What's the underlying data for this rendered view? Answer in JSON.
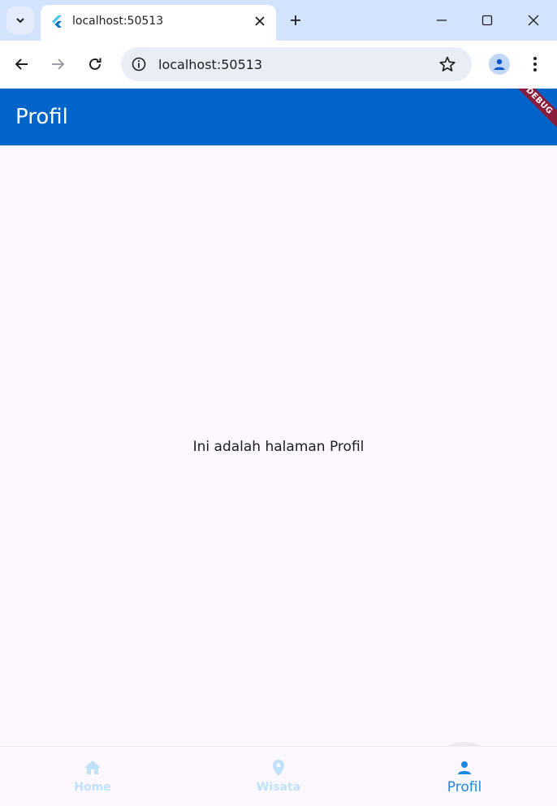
{
  "browser": {
    "tab_title": "localhost:50513",
    "url": "localhost:50513",
    "icons": {
      "tab_search": "chevron-down-icon",
      "favicon": "flutter-icon",
      "tab_close": "close-icon",
      "new_tab": "plus-icon",
      "minimize": "minimize-icon",
      "maximize": "maximize-icon",
      "close_window": "close-icon",
      "back": "arrow-left-icon",
      "forward": "arrow-right-icon",
      "reload": "reload-icon",
      "site_info": "info-icon",
      "bookmark": "star-icon",
      "profile": "person-icon",
      "menu": "kebab-menu-icon"
    }
  },
  "app": {
    "appbar_title": "Profil",
    "debug_banner": "DEBUG",
    "body_text": "Ini adalah halaman Profil",
    "colors": {
      "appbar": "#0064c8",
      "background": "#fdf7fe",
      "nav_active": "#1e88e5",
      "nav_inactive": "#bfe2fb",
      "debug_banner": "#8a1c3c"
    },
    "bottom_nav": {
      "items": [
        {
          "label": "Home",
          "icon": "home-icon",
          "active": false
        },
        {
          "label": "Wisata",
          "icon": "location-pin-icon",
          "active": false
        },
        {
          "label": "Profil",
          "icon": "person-icon",
          "active": true
        }
      ]
    }
  }
}
